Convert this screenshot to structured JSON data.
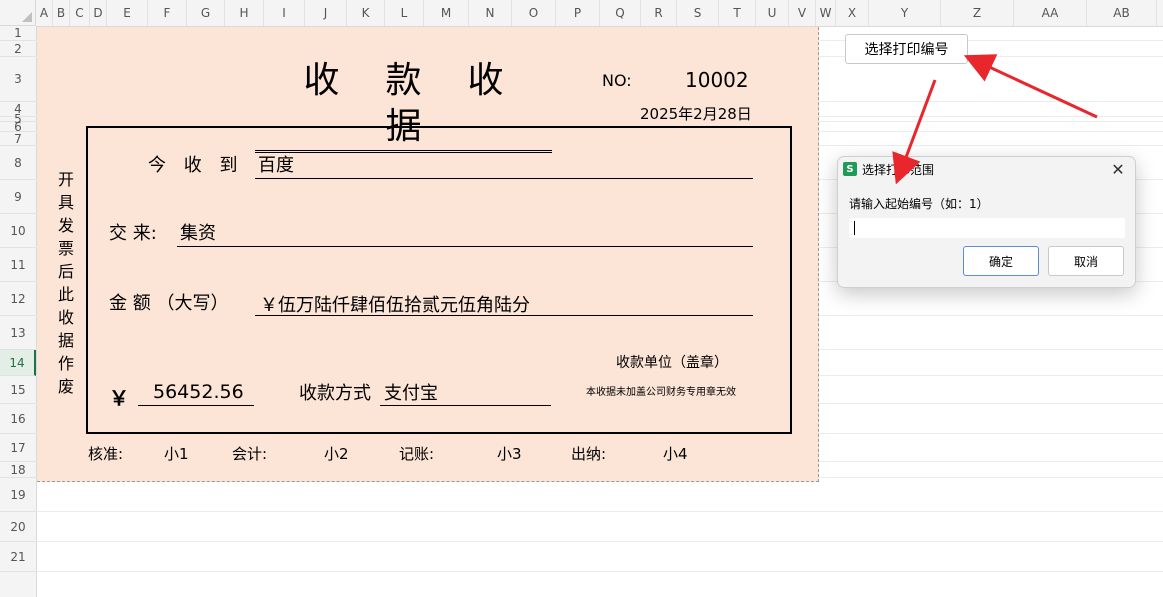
{
  "columns": [
    "A",
    "B",
    "C",
    "D",
    "E",
    "F",
    "G",
    "H",
    "I",
    "J",
    "K",
    "L",
    "M",
    "N",
    "O",
    "P",
    "Q",
    "R",
    "S",
    "T",
    "U",
    "V",
    "W",
    "X",
    "Y",
    "Z",
    "AA",
    "AB"
  ],
  "rows": [
    "1",
    "2",
    "3",
    "4",
    "5",
    "6",
    "7",
    "8",
    "9",
    "10",
    "11",
    "12",
    "13",
    "14",
    "15",
    "16",
    "17",
    "18",
    "19",
    "20",
    "21"
  ],
  "active_row": "14",
  "receipt": {
    "title": "收款收据",
    "no_label": "NO:",
    "no_value": "10002",
    "date": "2025年2月28日",
    "received_from_label": "今 收 到",
    "received_from_value": "百度",
    "paid_for_label": "交 来:",
    "paid_for_value": "集资",
    "amount_words_label": "金  额 （大写）",
    "amount_words_value": "￥伍万陆仟肆佰伍拾贰元伍角陆分",
    "currency_symbol": "￥",
    "amount_value": "56452.56",
    "method_label": "收款方式",
    "method_value": "支付宝",
    "unit_label": "收款单位（盖章）",
    "seal_note": "本收据未加盖公司财务专用章无效",
    "vertical_note": [
      "开",
      "具",
      "发",
      "票",
      "后",
      "此",
      "收",
      "据",
      "作",
      "废"
    ],
    "footer": [
      {
        "label": "核准:",
        "name": "小1"
      },
      {
        "label": "会计:",
        "name": "小2"
      },
      {
        "label": "记账:",
        "name": "小3"
      },
      {
        "label": "出纳:",
        "name": "小4"
      }
    ]
  },
  "toolbar": {
    "select_button": "选择打印编号"
  },
  "dialog": {
    "icon": "S",
    "title": "选择打印范围",
    "prompt": "请输入起始编号（如：1）",
    "input_value": "",
    "ok": "确定",
    "cancel": "取消"
  },
  "colors": {
    "print_area": "#fce4d6",
    "arrow": "#e8262c",
    "active_row": "#1e7145"
  }
}
